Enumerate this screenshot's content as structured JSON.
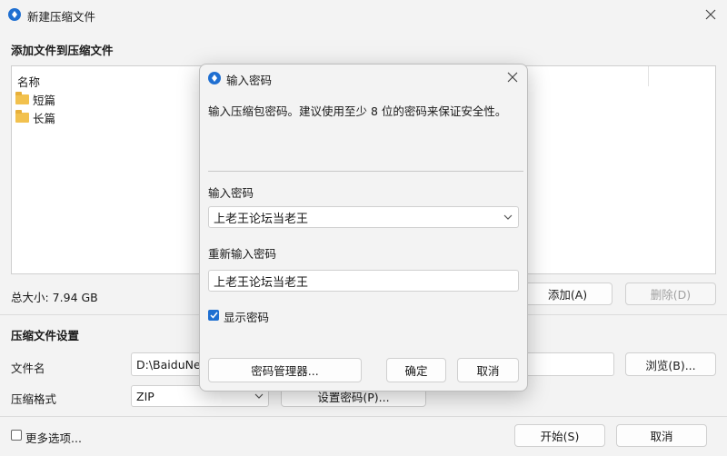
{
  "window": {
    "title": "新建压缩文件",
    "section_add": "添加文件到压缩文件",
    "list_header": "名称",
    "files": [
      {
        "name": "短篇",
        "icon": "folder-icon"
      },
      {
        "name": "长篇",
        "icon": "folder-icon"
      }
    ],
    "total_size": "总大小: 7.94 GB",
    "add_button": "添加(A)",
    "remove_button": "删除(D)",
    "settings_title": "压缩文件设置",
    "filename_label": "文件名",
    "filename_value": "D:\\BaiduNet",
    "browse_button": "浏览(B)...",
    "format_label": "压缩格式",
    "format_value": "ZIP",
    "set_password_button": "设置密码(P)...",
    "more_options_label": "更多选项...",
    "start_button": "开始(S)",
    "cancel_button": "取消"
  },
  "dialog": {
    "title": "输入密码",
    "description": "输入压缩包密码。建议使用至少 8 位的密码来保证安全性。",
    "password_label": "输入密码",
    "password_value": "上老王论坛当老王",
    "reenter_label": "重新输入密码",
    "reenter_value": "上老王论坛当老王",
    "show_password_label": "显示密码",
    "show_password_checked": true,
    "manager_button": "密码管理器...",
    "ok_button": "确定",
    "cancel_button": "取消"
  },
  "colors": {
    "accent": "#1f6fd1",
    "folder": "#f2c14e",
    "background": "#f3f3f3"
  }
}
